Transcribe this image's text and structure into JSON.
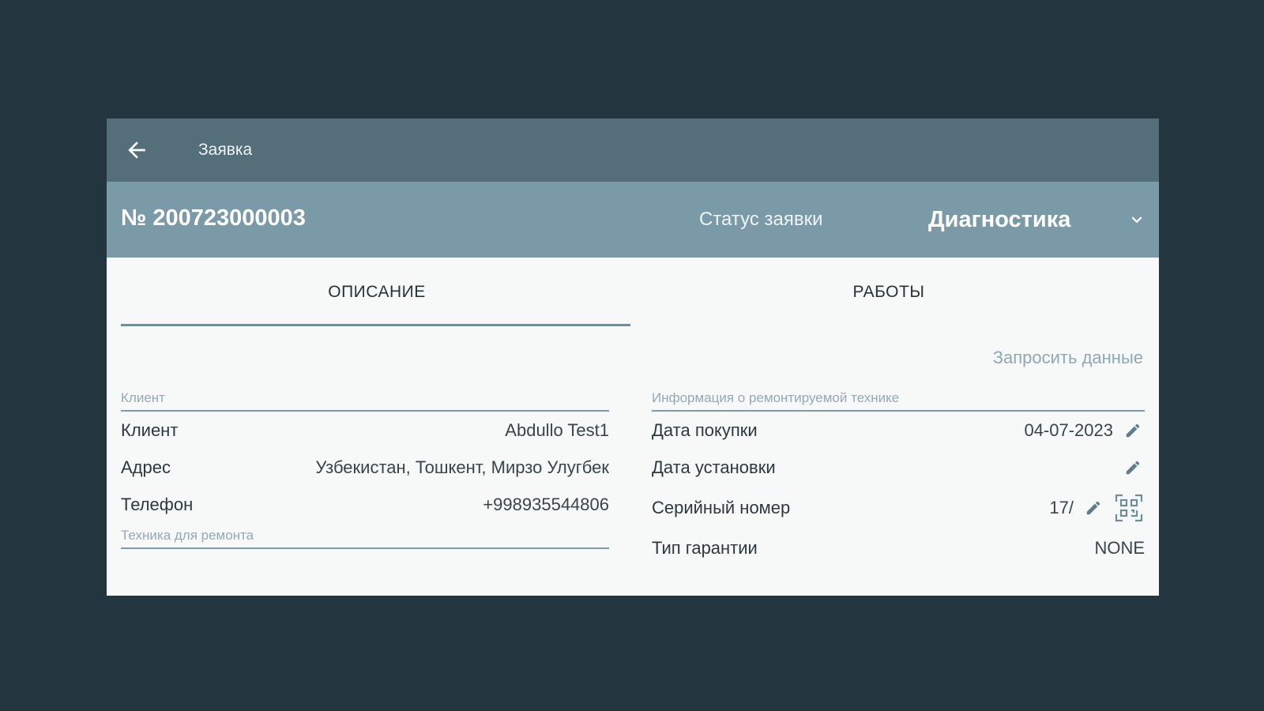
{
  "appbar": {
    "title": "Заявка"
  },
  "order": {
    "number": "№ 200723000003",
    "status_label": "Статус заявки",
    "status_value": "Диагностика"
  },
  "tabs": [
    {
      "label": "ОПИСАНИЕ"
    },
    {
      "label": "РАБОТЫ"
    }
  ],
  "request_data_link": "Запросить данные",
  "client_section": {
    "header": "Клиент",
    "rows": [
      {
        "label": "Клиент",
        "value": "Abdullo Test1"
      },
      {
        "label": "Адрес",
        "value": "Узбекистан, Тошкент, Мирзо Улугбек"
      },
      {
        "label": "Телефон",
        "value": "+998935544806"
      }
    ]
  },
  "equipment_section": {
    "header": "Техника для ремонта"
  },
  "repair_info_section": {
    "header": "Информация о ремонтируемой технике",
    "rows": [
      {
        "label": "Дата покупки",
        "value": "04-07-2023"
      },
      {
        "label": "Дата установки",
        "value": ""
      },
      {
        "label": "Серийный номер",
        "value": "17/"
      },
      {
        "label": "Тип гарантии",
        "value": "NONE"
      }
    ]
  },
  "colors": {
    "background": "#233640",
    "appbar": "#546e7a",
    "order_bar": "#7b9aa7",
    "accent": "#6d8e9c"
  }
}
